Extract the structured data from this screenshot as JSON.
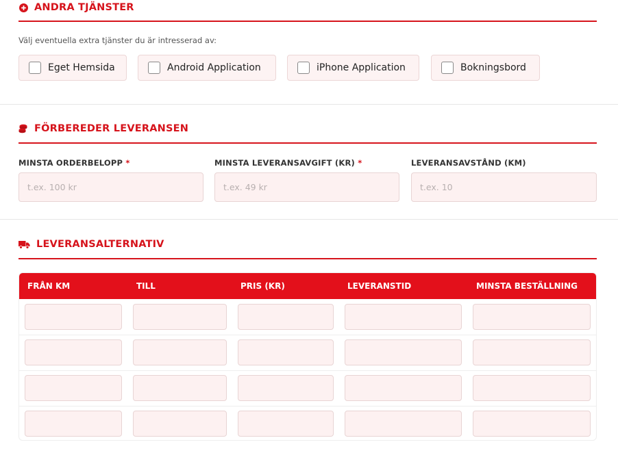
{
  "extras": {
    "title": "ANDRA TJÄNSTER",
    "hint": "Välj eventuella extra tjänster du är intresserad av:",
    "icon": "plus-circle-icon",
    "options": [
      {
        "label": "Eget Hemsida",
        "checked": false
      },
      {
        "label": "Android Application",
        "checked": false
      },
      {
        "label": "iPhone Application",
        "checked": false
      },
      {
        "label": "Bokningsbord",
        "checked": false
      }
    ]
  },
  "prep": {
    "title": "FÖRBEREDER LEVERANSEN",
    "icon": "coins-icon",
    "fields": [
      {
        "label": "MINSTA ORDERBELOPP",
        "required": "*",
        "placeholder": "t.ex. 100 kr",
        "value": ""
      },
      {
        "label": "MINSTA LEVERANSAVGIFT (KR)",
        "required": "*",
        "placeholder": "t.ex. 49 kr",
        "value": ""
      },
      {
        "label": "LEVERANSAVSTÅND (KM)",
        "required": "",
        "placeholder": "t.ex. 10",
        "value": ""
      }
    ]
  },
  "options": {
    "title": "LEVERANSALTERNATIV",
    "icon": "truck-icon",
    "columns": [
      "FRÅN KM",
      "TILL",
      "PRIS (KR)",
      "LEVERANSTID",
      "MINSTA BESTÄLLNING"
    ],
    "rows": [
      [
        "",
        "",
        "",
        "",
        ""
      ],
      [
        "",
        "",
        "",
        "",
        ""
      ],
      [
        "",
        "",
        "",
        "",
        ""
      ],
      [
        "",
        "",
        "",
        "",
        ""
      ]
    ]
  },
  "colors": {
    "accent": "#d6131b",
    "header_bg": "#e3101b",
    "input_bg": "#fdf1f1"
  }
}
